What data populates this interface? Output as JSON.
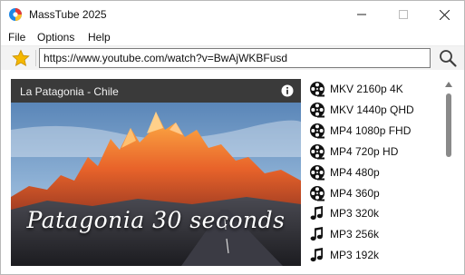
{
  "window": {
    "title": "MassTube 2025"
  },
  "menu": {
    "items": [
      "File",
      "Options",
      "Help"
    ]
  },
  "toolbar": {
    "url_value": "https://www.youtube.com/watch?v=BwAjWKBFusd"
  },
  "video": {
    "header_title": "La Patagonia - Chile",
    "caption": "Patagonia 30 seconds"
  },
  "formats": [
    {
      "label": "MKV 2160p 4K",
      "icon": "film-reel-icon"
    },
    {
      "label": "MKV 1440p QHD",
      "icon": "film-reel-icon"
    },
    {
      "label": "MP4 1080p FHD",
      "icon": "film-reel-icon"
    },
    {
      "label": "MP4 720p HD",
      "icon": "film-reel-icon"
    },
    {
      "label": "MP4 480p",
      "icon": "film-reel-icon"
    },
    {
      "label": "MP4 360p",
      "icon": "film-reel-icon"
    },
    {
      "label": "MP3 320k",
      "icon": "music-note-icon"
    },
    {
      "label": "MP3 256k",
      "icon": "music-note-icon"
    },
    {
      "label": "MP3 192k",
      "icon": "music-note-icon"
    }
  ],
  "colors": {
    "star": "#f5b800",
    "video_header": "#3a3a3a",
    "scroll_thumb": "#8a8a8a"
  }
}
